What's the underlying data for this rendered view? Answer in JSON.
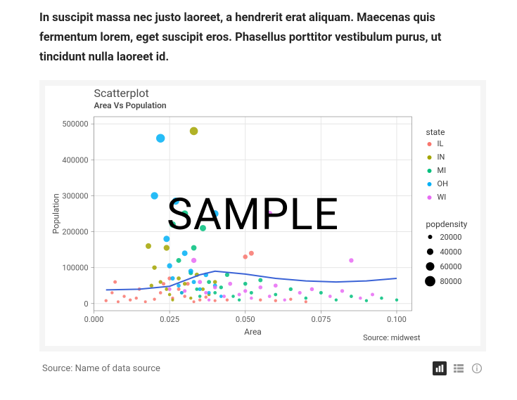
{
  "intro_text": "In suscipit massa nec justo laoreet, a hendrerit erat aliquam. Maecenas quis fermentum lorem, eget suscipit eros. Phasellus porttitor vestibulum purus, ut tincidunt nulla laoreet id.",
  "figure_caption": "Source: Name of data source",
  "chart_data": {
    "type": "scatter",
    "title": "Scatterplot",
    "subtitle": "Area Vs Population",
    "xlabel": "Area",
    "ylabel": "Population",
    "xlim": [
      0,
      0.105
    ],
    "ylim": [
      -20000,
      520000
    ],
    "x_ticks": [
      0.0,
      0.025,
      0.05,
      0.075,
      0.1
    ],
    "y_ticks": [
      0,
      100000,
      200000,
      300000,
      400000,
      500000
    ],
    "caption": "Source: midwest",
    "watermark": "SAMPLE",
    "color_legend_title": "state",
    "color_legend": [
      {
        "key": "IL",
        "color": "#F8766D"
      },
      {
        "key": "IN",
        "color": "#A3A500"
      },
      {
        "key": "MI",
        "color": "#00BF7D"
      },
      {
        "key": "OH",
        "color": "#00B0F6"
      },
      {
        "key": "WI",
        "color": "#E76BF3"
      }
    ],
    "size_legend_title": "popdensity",
    "size_legend": [
      {
        "value": 20000,
        "r": 3.0
      },
      {
        "value": 40000,
        "r": 4.6
      },
      {
        "value": 60000,
        "r": 6.0
      },
      {
        "value": 80000,
        "r": 7.4
      }
    ],
    "loess_line": [
      {
        "x": 0.004,
        "y": 38000
      },
      {
        "x": 0.015,
        "y": 40000
      },
      {
        "x": 0.025,
        "y": 48000
      },
      {
        "x": 0.035,
        "y": 80000
      },
      {
        "x": 0.04,
        "y": 90000
      },
      {
        "x": 0.05,
        "y": 82000
      },
      {
        "x": 0.06,
        "y": 70000
      },
      {
        "x": 0.07,
        "y": 63000
      },
      {
        "x": 0.08,
        "y": 60000
      },
      {
        "x": 0.09,
        "y": 63000
      },
      {
        "x": 0.1,
        "y": 70000
      }
    ],
    "series": [
      {
        "name": "IL",
        "color": "#F8766D",
        "points": [
          {
            "x": 0.004,
            "y": 8000,
            "r": 2.2
          },
          {
            "x": 0.006,
            "y": 30000,
            "r": 2.2
          },
          {
            "x": 0.007,
            "y": 60000,
            "r": 2.5
          },
          {
            "x": 0.008,
            "y": 5000,
            "r": 2.0
          },
          {
            "x": 0.01,
            "y": 20000,
            "r": 2.2
          },
          {
            "x": 0.012,
            "y": 10000,
            "r": 2.2
          },
          {
            "x": 0.014,
            "y": 15000,
            "r": 2.2
          },
          {
            "x": 0.015,
            "y": 40000,
            "r": 2.4
          },
          {
            "x": 0.017,
            "y": 5000,
            "r": 2.0
          },
          {
            "x": 0.02,
            "y": 12000,
            "r": 2.2
          },
          {
            "x": 0.022,
            "y": 30000,
            "r": 2.3
          },
          {
            "x": 0.023,
            "y": 55000,
            "r": 2.6
          },
          {
            "x": 0.025,
            "y": 70000,
            "r": 2.8
          },
          {
            "x": 0.026,
            "y": 15000,
            "r": 2.2
          },
          {
            "x": 0.028,
            "y": 40000,
            "r": 2.5
          },
          {
            "x": 0.03,
            "y": 20000,
            "r": 2.3
          },
          {
            "x": 0.031,
            "y": 55000,
            "r": 2.7
          },
          {
            "x": 0.033,
            "y": 5000,
            "r": 2.0
          },
          {
            "x": 0.035,
            "y": 10000,
            "r": 2.2
          },
          {
            "x": 0.037,
            "y": 18000,
            "r": 2.3
          },
          {
            "x": 0.04,
            "y": 8000,
            "r": 2.1
          },
          {
            "x": 0.044,
            "y": 10000,
            "r": 2.2
          },
          {
            "x": 0.05,
            "y": 130000,
            "r": 3.3
          },
          {
            "x": 0.055,
            "y": 10000,
            "r": 2.2
          },
          {
            "x": 0.06,
            "y": 8000,
            "r": 2.2
          },
          {
            "x": 0.065,
            "y": 12000,
            "r": 2.2
          },
          {
            "x": 0.07,
            "y": 5000,
            "r": 2.1
          },
          {
            "x": 0.052,
            "y": 140000,
            "r": 3.5
          }
        ]
      },
      {
        "name": "IN",
        "color": "#A3A500",
        "points": [
          {
            "x": 0.018,
            "y": 160000,
            "r": 4.0
          },
          {
            "x": 0.02,
            "y": 100000,
            "r": 3.2
          },
          {
            "x": 0.022,
            "y": 60000,
            "r": 2.7
          },
          {
            "x": 0.024,
            "y": 40000,
            "r": 2.5
          },
          {
            "x": 0.025,
            "y": 25000,
            "r": 2.3
          },
          {
            "x": 0.026,
            "y": 10000,
            "r": 2.1
          },
          {
            "x": 0.028,
            "y": 70000,
            "r": 2.9
          },
          {
            "x": 0.029,
            "y": 30000,
            "r": 2.4
          },
          {
            "x": 0.03,
            "y": 55000,
            "r": 2.7
          },
          {
            "x": 0.032,
            "y": 15000,
            "r": 2.2
          },
          {
            "x": 0.033,
            "y": 480000,
            "r": 5.8
          },
          {
            "x": 0.034,
            "y": 80000,
            "r": 3.1
          },
          {
            "x": 0.036,
            "y": 40000,
            "r": 2.6
          },
          {
            "x": 0.038,
            "y": 25000,
            "r": 2.3
          },
          {
            "x": 0.04,
            "y": 60000,
            "r": 2.8
          },
          {
            "x": 0.024,
            "y": 155000,
            "r": 4.2
          },
          {
            "x": 0.019,
            "y": 50000,
            "r": 2.7
          }
        ]
      },
      {
        "name": "MI",
        "color": "#00BF7D",
        "points": [
          {
            "x": 0.026,
            "y": 220000,
            "r": 4.5
          },
          {
            "x": 0.028,
            "y": 120000,
            "r": 3.5
          },
          {
            "x": 0.03,
            "y": 250000,
            "r": 4.8
          },
          {
            "x": 0.032,
            "y": 85000,
            "r": 3.1
          },
          {
            "x": 0.033,
            "y": 155000,
            "r": 3.9
          },
          {
            "x": 0.034,
            "y": 40000,
            "r": 2.5
          },
          {
            "x": 0.035,
            "y": 20000,
            "r": 2.3
          },
          {
            "x": 0.036,
            "y": 210000,
            "r": 4.5
          },
          {
            "x": 0.038,
            "y": 60000,
            "r": 2.9
          },
          {
            "x": 0.04,
            "y": 30000,
            "r": 2.4
          },
          {
            "x": 0.042,
            "y": 45000,
            "r": 2.7
          },
          {
            "x": 0.044,
            "y": 80000,
            "r": 3.1
          },
          {
            "x": 0.046,
            "y": 20000,
            "r": 2.3
          },
          {
            "x": 0.048,
            "y": 10000,
            "r": 2.2
          },
          {
            "x": 0.05,
            "y": 55000,
            "r": 2.8
          },
          {
            "x": 0.052,
            "y": 30000,
            "r": 2.5
          },
          {
            "x": 0.055,
            "y": 65000,
            "r": 3.0
          },
          {
            "x": 0.06,
            "y": 25000,
            "r": 2.4
          },
          {
            "x": 0.065,
            "y": 40000,
            "r": 2.7
          },
          {
            "x": 0.07,
            "y": 15000,
            "r": 2.3
          },
          {
            "x": 0.075,
            "y": 30000,
            "r": 2.5
          },
          {
            "x": 0.08,
            "y": 10000,
            "r": 2.2
          },
          {
            "x": 0.085,
            "y": 20000,
            "r": 2.4
          },
          {
            "x": 0.09,
            "y": 8000,
            "r": 2.2
          },
          {
            "x": 0.095,
            "y": 15000,
            "r": 2.3
          },
          {
            "x": 0.1,
            "y": 10000,
            "r": 2.2
          }
        ]
      },
      {
        "name": "OH",
        "color": "#00B0F6",
        "points": [
          {
            "x": 0.02,
            "y": 300000,
            "r": 5.2
          },
          {
            "x": 0.022,
            "y": 460000,
            "r": 6.2
          },
          {
            "x": 0.024,
            "y": 180000,
            "r": 4.5
          },
          {
            "x": 0.025,
            "y": 105000,
            "r": 3.7
          },
          {
            "x": 0.026,
            "y": 70000,
            "r": 3.1
          },
          {
            "x": 0.027,
            "y": 285000,
            "r": 5.1
          },
          {
            "x": 0.028,
            "y": 50000,
            "r": 2.8
          },
          {
            "x": 0.029,
            "y": 30000,
            "r": 2.5
          },
          {
            "x": 0.03,
            "y": 140000,
            "r": 4.0
          },
          {
            "x": 0.032,
            "y": 90000,
            "r": 3.5
          },
          {
            "x": 0.033,
            "y": 60000,
            "r": 3.0
          },
          {
            "x": 0.035,
            "y": 40000,
            "r": 2.7
          },
          {
            "x": 0.037,
            "y": 80000,
            "r": 3.3
          },
          {
            "x": 0.038,
            "y": 30000,
            "r": 2.5
          },
          {
            "x": 0.04,
            "y": 50000,
            "r": 2.9
          },
          {
            "x": 0.042,
            "y": 20000,
            "r": 2.4
          },
          {
            "x": 0.04,
            "y": 250000,
            "r": 5.0
          }
        ]
      },
      {
        "name": "WI",
        "color": "#E76BF3",
        "points": [
          {
            "x": 0.025,
            "y": 40000,
            "r": 2.6
          },
          {
            "x": 0.03,
            "y": 35000,
            "r": 2.6
          },
          {
            "x": 0.033,
            "y": 120000,
            "r": 3.7
          },
          {
            "x": 0.035,
            "y": 60000,
            "r": 3.0
          },
          {
            "x": 0.037,
            "y": 30000,
            "r": 2.5
          },
          {
            "x": 0.038,
            "y": 10000,
            "r": 2.2
          },
          {
            "x": 0.04,
            "y": 45000,
            "r": 2.8
          },
          {
            "x": 0.043,
            "y": 20000,
            "r": 2.4
          },
          {
            "x": 0.045,
            "y": 55000,
            "r": 2.9
          },
          {
            "x": 0.048,
            "y": 25000,
            "r": 2.5
          },
          {
            "x": 0.05,
            "y": 35000,
            "r": 2.7
          },
          {
            "x": 0.052,
            "y": 15000,
            "r": 2.3
          },
          {
            "x": 0.055,
            "y": 45000,
            "r": 2.8
          },
          {
            "x": 0.058,
            "y": 20000,
            "r": 2.4
          },
          {
            "x": 0.06,
            "y": 50000,
            "r": 2.9
          },
          {
            "x": 0.063,
            "y": 10000,
            "r": 2.2
          },
          {
            "x": 0.058,
            "y": 250000,
            "r": 4.0
          },
          {
            "x": 0.068,
            "y": 30000,
            "r": 2.6
          },
          {
            "x": 0.072,
            "y": 40000,
            "r": 2.8
          },
          {
            "x": 0.078,
            "y": 20000,
            "r": 2.4
          },
          {
            "x": 0.082,
            "y": 35000,
            "r": 2.7
          },
          {
            "x": 0.088,
            "y": 15000,
            "r": 2.3
          },
          {
            "x": 0.085,
            "y": 120000,
            "r": 3.2
          },
          {
            "x": 0.092,
            "y": 25000,
            "r": 2.5
          }
        ]
      }
    ]
  }
}
